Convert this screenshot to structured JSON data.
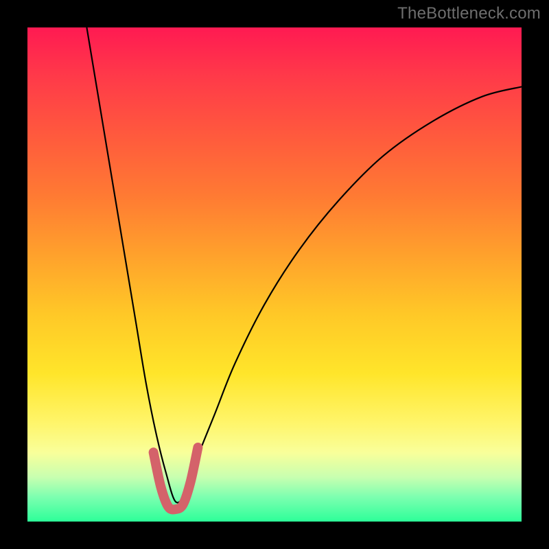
{
  "watermark": "TheBottleneck.com",
  "chart_data": {
    "type": "line",
    "title": "",
    "xlabel": "",
    "ylabel": "",
    "xlim": [
      0,
      100
    ],
    "ylim": [
      0,
      100
    ],
    "grid": false,
    "series": [
      {
        "name": "bottleneck-curve",
        "stroke": "#000000",
        "stroke_width": 2.2,
        "x": [
          12,
          14,
          16,
          18,
          20,
          22,
          24,
          26,
          28,
          30,
          32,
          34,
          38,
          42,
          48,
          55,
          63,
          72,
          82,
          92,
          100
        ],
        "y": [
          100,
          88,
          76,
          64,
          52,
          40,
          28,
          18,
          10,
          4,
          6,
          12,
          22,
          32,
          44,
          55,
          65,
          74,
          81,
          86,
          88
        ]
      },
      {
        "name": "optimal-band",
        "stroke": "#d4626a",
        "stroke_width": 14,
        "linecap": "round",
        "x": [
          25.5,
          27.0,
          28.5,
          30.0,
          31.5,
          33.0,
          34.5
        ],
        "y": [
          14.0,
          7.0,
          3.0,
          2.5,
          3.5,
          8.0,
          15.0
        ]
      }
    ]
  }
}
